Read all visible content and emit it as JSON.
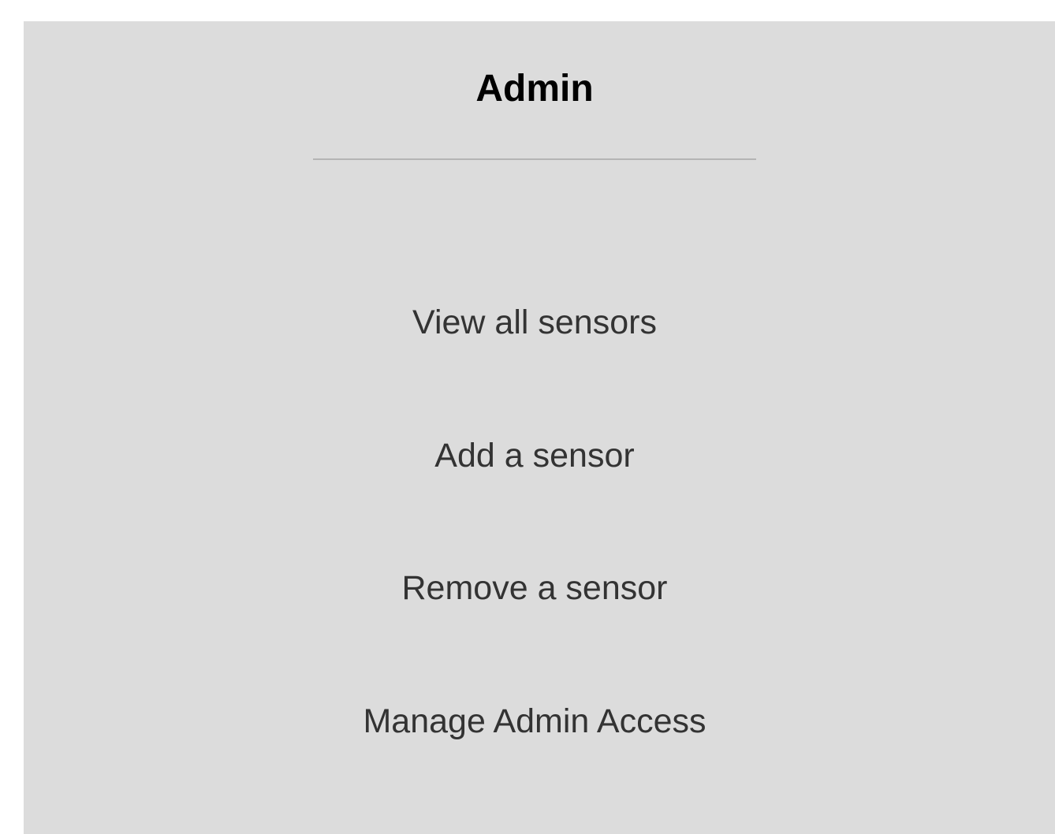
{
  "admin_panel": {
    "title": "Admin",
    "menu_items": [
      {
        "label": "View all sensors"
      },
      {
        "label": "Add a sensor"
      },
      {
        "label": "Remove a sensor"
      },
      {
        "label": "Manage Admin Access"
      }
    ]
  },
  "colors": {
    "panel_background": "#dcdcdc",
    "title_text": "#000000",
    "menu_text": "#333333",
    "divider": "#b4b4b4"
  }
}
